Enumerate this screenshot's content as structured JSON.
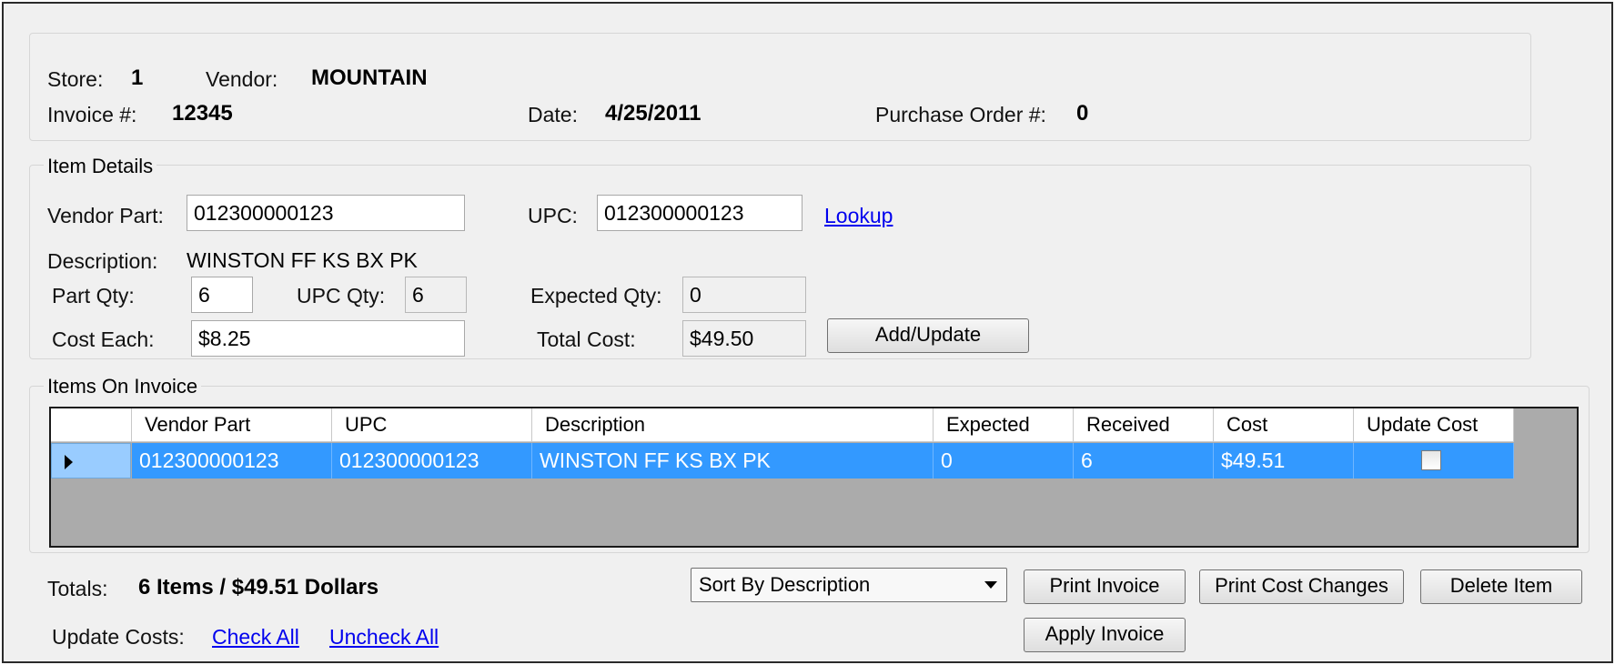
{
  "header": {
    "store_label": "Store:",
    "store_value": "1",
    "vendor_label": "Vendor:",
    "vendor_value": "MOUNTAIN",
    "invoice_label": "Invoice #:",
    "invoice_value": "12345",
    "date_label": "Date:",
    "date_value": "4/25/2011",
    "po_label": "Purchase Order #:",
    "po_value": "0"
  },
  "item_details": {
    "title": "Item Details",
    "vendor_part_label": "Vendor Part:",
    "vendor_part_value": "012300000123",
    "upc_label": "UPC:",
    "upc_value": "012300000123",
    "lookup_link": "Lookup",
    "description_label": "Description:",
    "description_value": "WINSTON FF KS BX PK",
    "part_qty_label": "Part Qty:",
    "part_qty_value": "6",
    "upc_qty_label": "UPC Qty:",
    "upc_qty_value": "6",
    "expected_qty_label": "Expected Qty:",
    "expected_qty_value": "0",
    "cost_each_label": "Cost Each:",
    "cost_each_value": "$8.25",
    "total_cost_label": "Total Cost:",
    "total_cost_value": "$49.50",
    "add_update_button": "Add/Update"
  },
  "items_on_invoice": {
    "title": "Items On Invoice",
    "columns": [
      "Vendor Part",
      "UPC",
      "Description",
      "Expected",
      "Received",
      "Cost",
      "Update Cost"
    ],
    "rows": [
      {
        "vendor_part": "012300000123",
        "upc": "012300000123",
        "description": "WINSTON FF KS BX PK",
        "expected": "0",
        "received": "6",
        "cost": "$49.51",
        "update_cost": false
      }
    ]
  },
  "footer": {
    "totals_label": "Totals:",
    "totals_value": "6 Items / $49.51 Dollars",
    "update_costs_label": "Update Costs:",
    "check_all_link": "Check All",
    "uncheck_all_link": "Uncheck All",
    "sort_selected": "Sort By Description",
    "print_invoice_button": "Print Invoice",
    "print_cost_changes_button": "Print Cost Changes",
    "delete_item_button": "Delete Item",
    "apply_invoice_button": "Apply Invoice"
  }
}
